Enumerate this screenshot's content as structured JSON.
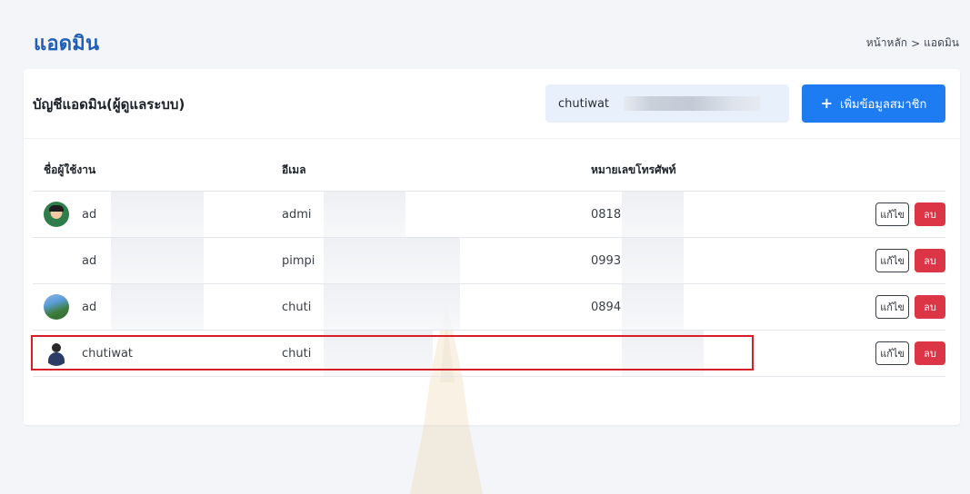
{
  "header": {
    "title": "แอดมิน",
    "breadcrumb": {
      "home": "หน้าหลัก",
      "separator": ">",
      "current": "แอดมิน"
    }
  },
  "card": {
    "title": "บัญชีแอดมิน(ผู้ดูแลระบบ)",
    "search": {
      "value": "chutiwat"
    },
    "add_button": {
      "icon": "plus-icon",
      "label": "เพิ่มข้อมูลสมาชิก"
    }
  },
  "table": {
    "columns": [
      "ชื่อผู้ใช้งาน",
      "อีเมล",
      "หมายเลขโทรศัพท์"
    ],
    "rows": [
      {
        "avatar": "avatar-cartoon-boy",
        "name": "ad",
        "email": "admi",
        "phone": "0818",
        "edit": "แก้ไข",
        "delete": "ลบ"
      },
      {
        "avatar": "",
        "name": "ad",
        "email": "pimpi",
        "phone": "0993",
        "edit": "แก้ไข",
        "delete": "ลบ"
      },
      {
        "avatar": "avatar-photo-outdoor",
        "name": "ad",
        "email": "chuti",
        "phone": "0894",
        "edit": "แก้ไข",
        "delete": "ลบ"
      },
      {
        "avatar": "avatar-person-suit",
        "name": "chutiwat",
        "email": "chuti",
        "phone": "",
        "edit": "แก้ไข",
        "delete": "ลบ"
      }
    ]
  },
  "colors": {
    "title": "#1f5fb8",
    "primary_button": "#1d7cf2",
    "delete_button": "#dc3545",
    "highlight": "#d61f26",
    "search_background": "#e8f0fb"
  }
}
